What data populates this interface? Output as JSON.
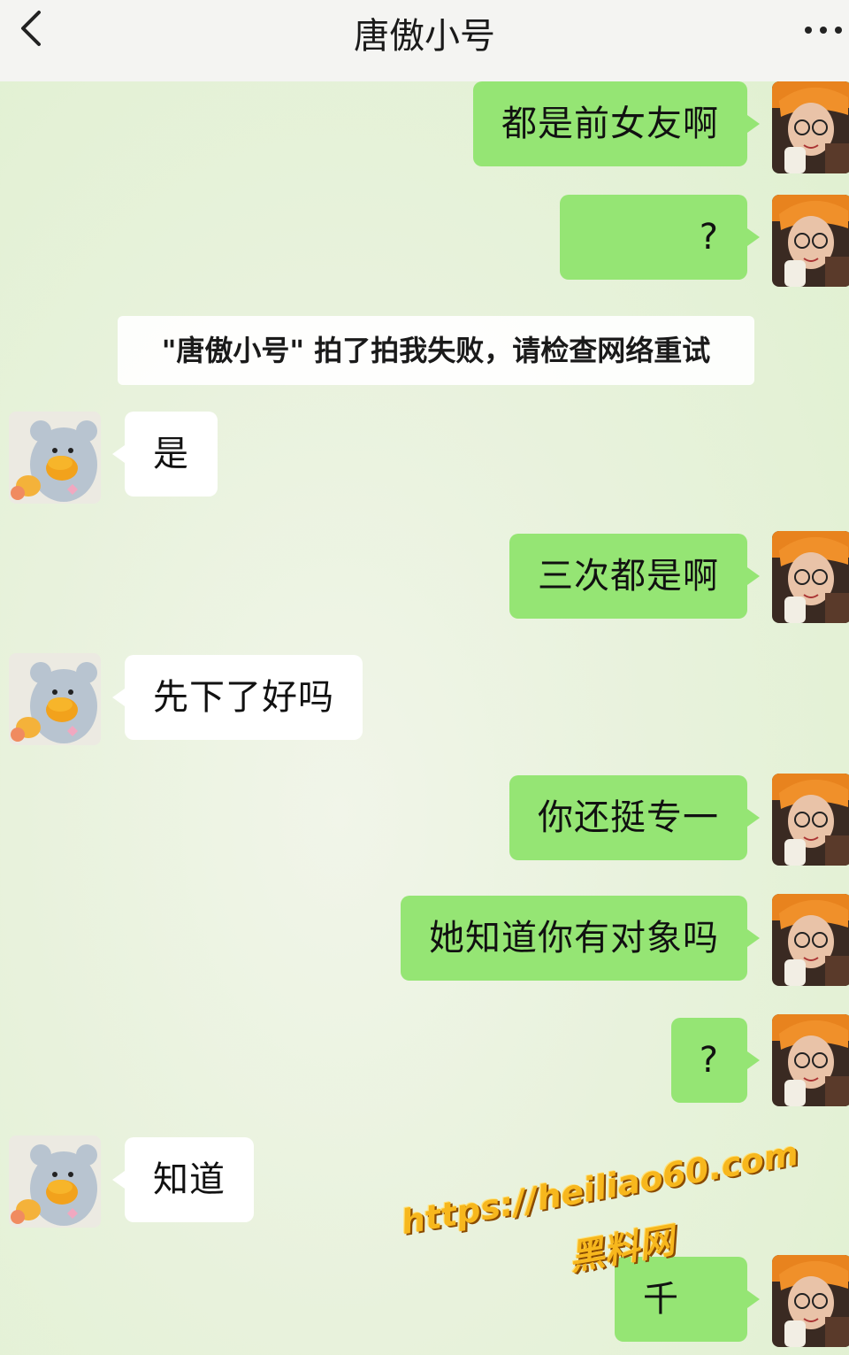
{
  "header": {
    "title": "唐傲小号",
    "back_icon": "chevron-left-icon",
    "more_icon": "more-dots-icon"
  },
  "messages": [
    {
      "side": "me",
      "text": "都是前女友啊"
    },
    {
      "side": "me",
      "text": "?"
    },
    {
      "side": "system",
      "text": "\"唐傲小号\" 拍了拍我失败，请检查网络重试"
    },
    {
      "side": "other",
      "text": "是"
    },
    {
      "side": "me",
      "text": "三次都是啊"
    },
    {
      "side": "other",
      "text": "先下了好吗"
    },
    {
      "side": "me",
      "text": "你还挺专一"
    },
    {
      "side": "me",
      "text": "她知道你有对象吗"
    },
    {
      "side": "me",
      "text": "?"
    },
    {
      "side": "other",
      "text": "知道"
    },
    {
      "side": "me",
      "text": "千"
    }
  ],
  "watermark": {
    "url": "https://heiliao60.com",
    "name": "黑料网"
  },
  "colors": {
    "my_bubble": "#95e574",
    "other_bubble": "#ffffff",
    "header_bg": "#f4f4f2"
  }
}
